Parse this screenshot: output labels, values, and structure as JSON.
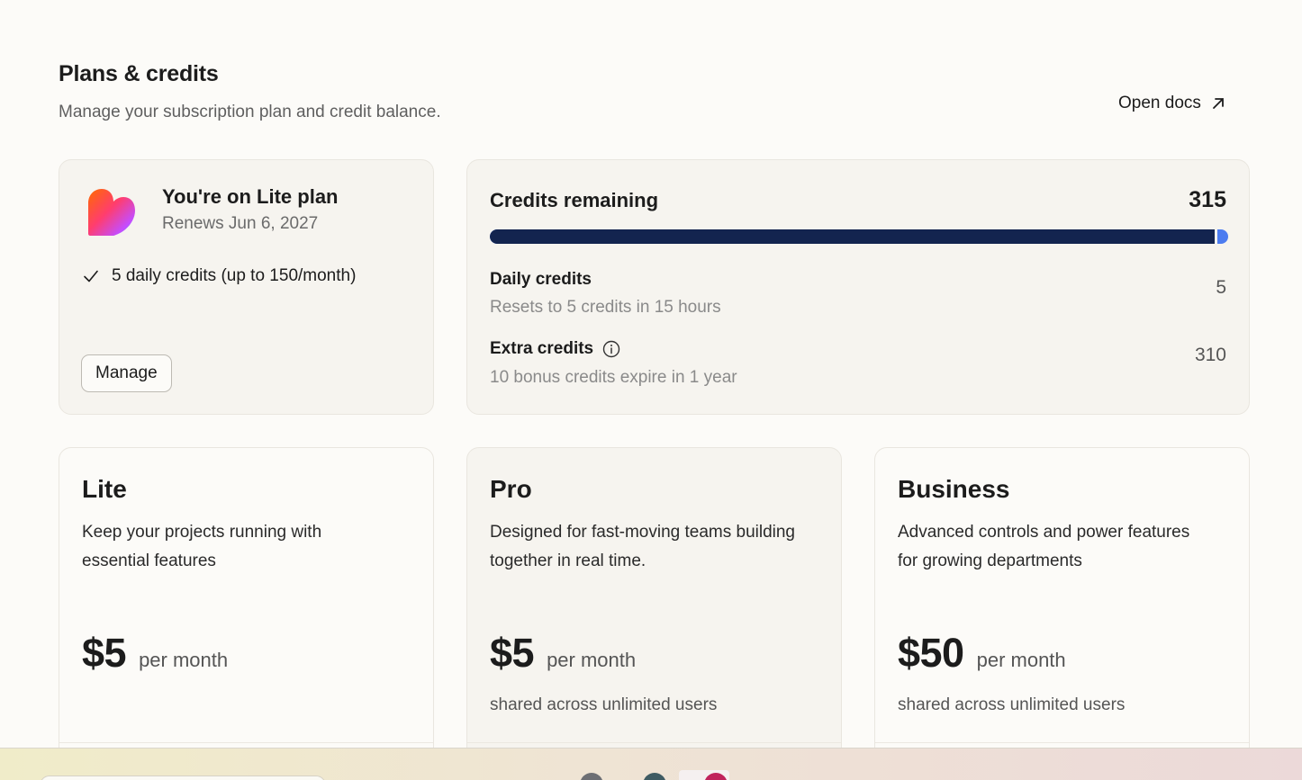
{
  "header": {
    "title": "Plans & credits",
    "subtitle": "Manage your subscription plan and credit balance.",
    "open_docs_label": "Open docs"
  },
  "current_plan": {
    "title": "You're on Lite plan",
    "renews": "Renews Jun 6, 2027",
    "feature": "5 daily credits (up to 150/month)",
    "manage_label": "Manage"
  },
  "credits": {
    "title": "Credits remaining",
    "total": "315",
    "progress_fraction": 0.985,
    "daily": {
      "label": "Daily credits",
      "sub": "Resets to 5 credits in 15 hours",
      "value": "5"
    },
    "extra": {
      "label": "Extra credits",
      "sub": "10 bonus credits expire in 1 year",
      "value": "310"
    }
  },
  "tiers": [
    {
      "name": "Lite",
      "description": "Keep your projects running with essential features",
      "price": "$5",
      "per": "per month",
      "note": ""
    },
    {
      "name": "Pro",
      "description": "Designed for fast-moving teams building together in real time.",
      "price": "$5",
      "per": "per month",
      "note": "shared across unlimited users"
    },
    {
      "name": "Business",
      "description": "Advanced controls and power features for growing departments",
      "price": "$50",
      "per": "per month",
      "note": "shared across unlimited users"
    }
  ],
  "colors": {
    "progress_used": "#13244f",
    "progress_remaining": "#4c7cf0",
    "page_bg": "#fcfbf8",
    "card_bg": "#f6f4ef"
  }
}
